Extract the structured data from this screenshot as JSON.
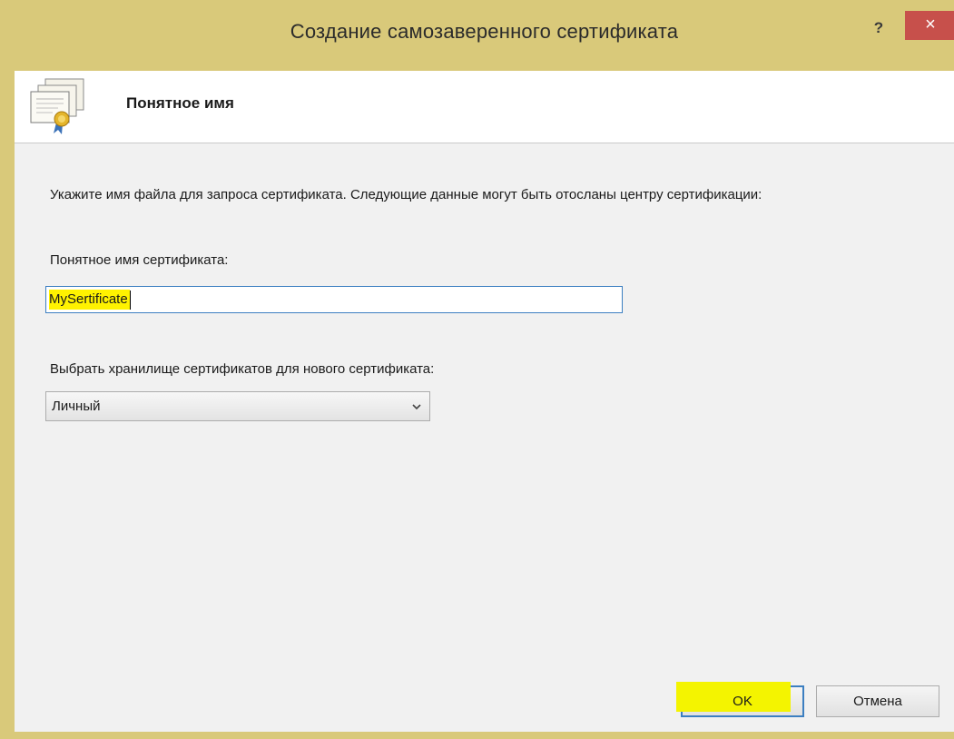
{
  "window": {
    "title": "Создание самозаверенного сертификата",
    "help_glyph": "?",
    "close_glyph": "×",
    "accent_color": "#d9c97a",
    "close_color": "#c7504b"
  },
  "header": {
    "icon": "certificate-icon",
    "title": "Понятное имя"
  },
  "form": {
    "description": "Укажите имя файла для запроса сертификата. Следующие данные могут быть отосланы центру сертификации:",
    "friendly_name_label": "Понятное имя сертификата:",
    "friendly_name_value": "MySertificate",
    "store_label": "Выбрать хранилище сертификатов для нового сертификата:",
    "store_selected": "Личный",
    "highlight_color": "#fff200"
  },
  "buttons": {
    "ok": "OK",
    "cancel": "Отмена"
  }
}
